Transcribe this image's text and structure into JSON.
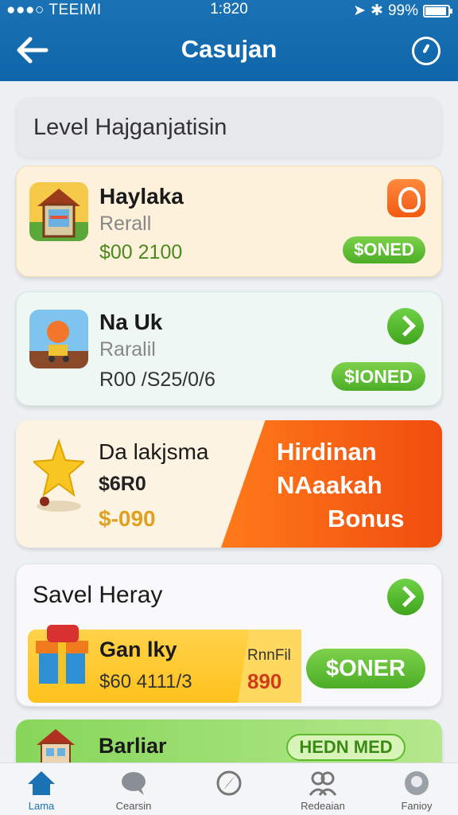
{
  "status_bar": {
    "carrier": "●●●○ TEEIMI",
    "time": "1:820",
    "battery": "99%"
  },
  "header": {
    "title": "Casujan",
    "back_icon": "arrow-left-icon",
    "action_icon": "compass-icon"
  },
  "search": {
    "text": "Level Hajganjatisin"
  },
  "cards": [
    {
      "title": "Haylaka",
      "subtitle": "Rerall",
      "price": "$00 2100",
      "button": "$ONED",
      "icon": "house-icon",
      "badge_icon": "fire-icon"
    },
    {
      "title": "Na Uk",
      "subtitle": "Raralil",
      "price": "R00 /S25/0/6",
      "button": "$IONED",
      "icon": "balloon-cart-icon",
      "badge_icon": "chevron-right-icon"
    },
    {
      "title": "Da lakjsma",
      "subtitle": "$6R0",
      "price": "$-090",
      "promo": [
        "Hirdinan",
        "NAaakah",
        "Bonus"
      ],
      "icon": "star-icon"
    },
    {
      "title": "Savel Heray",
      "inner_title": "Gan lky",
      "inner_price": "$60 4111/3",
      "inner_label": "RnnFil",
      "inner_value": "890",
      "button": "$ONER",
      "icon": "gift-box-icon",
      "badge_icon": "chevron-right-icon"
    },
    {
      "title": "Barliar",
      "button": "HEDN MED",
      "icon": "house-icon"
    }
  ],
  "bottom_nav": [
    {
      "label": "Lama",
      "icon": "home-icon",
      "active": true
    },
    {
      "label": "Cearsin",
      "icon": "chat-icon",
      "active": false
    },
    {
      "label": "",
      "icon": "compass-icon",
      "active": false
    },
    {
      "label": "Redeaian",
      "icon": "users-icon",
      "active": false
    },
    {
      "label": "Fanioy",
      "icon": "profile-icon",
      "active": false
    }
  ],
  "colors": {
    "header": "#1a72b4",
    "accent_green": "#4cae26",
    "accent_orange": "#f25a12"
  }
}
